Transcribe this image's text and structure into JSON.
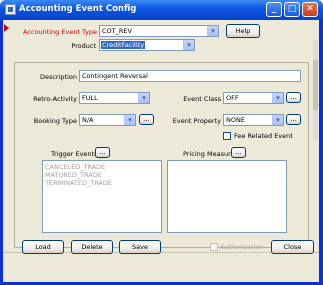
{
  "window": {
    "title": "Accounting Event Config"
  },
  "titlebar_buttons": {
    "minimize": "_",
    "maximize": "□",
    "close": "✕"
  },
  "header": {
    "event_type_label": "Accounting Event Type",
    "event_type_value": "COT_REV",
    "help_label": "Help",
    "product_label": "Product",
    "product_value": "CreditFacility"
  },
  "form": {
    "description_label": "Description",
    "description_value": "Contingent Reversal",
    "retro_label": "Retro-Activity",
    "retro_value": "FULL",
    "event_class_label": "Event Class",
    "event_class_value": "OFF",
    "booking_type_label": "Booking Type",
    "booking_type_value": "N/A",
    "event_property_label": "Event Property",
    "event_property_value": "NONE",
    "fee_related_label": "Fee Related Event",
    "ellipsis": "..."
  },
  "trigger": {
    "label": "Trigger Events",
    "items": [
      "CANCELED_TRADE",
      "MATURED_TRADE",
      "TERMINATED_TRADE"
    ]
  },
  "pricing": {
    "label": "Pricing Measures"
  },
  "footer": {
    "load": "Load",
    "delete": "Delete",
    "save": "Save",
    "authorization": "Authorization",
    "close": "Close"
  },
  "icons": {
    "dropdown": "▾"
  }
}
